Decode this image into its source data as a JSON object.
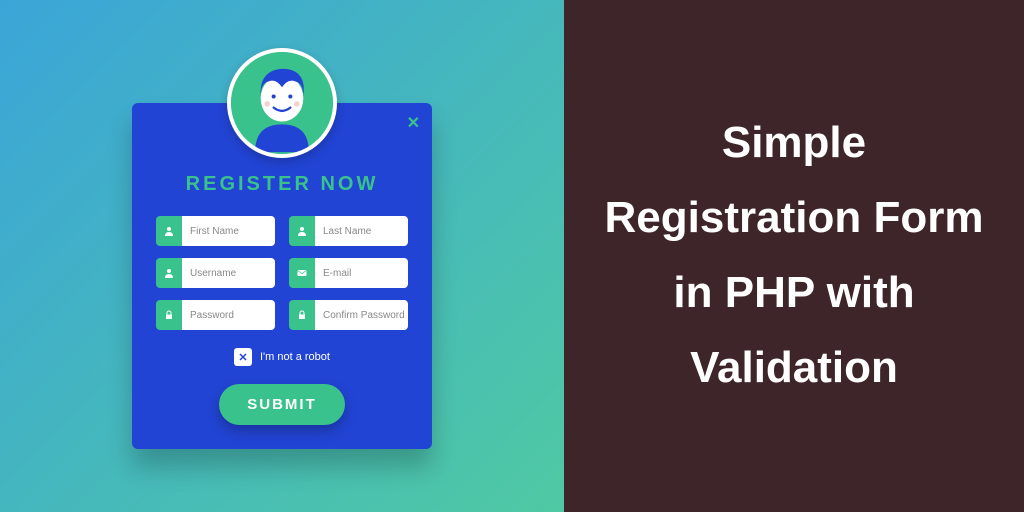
{
  "rightPanel": {
    "title": "Simple Registration Form in PHP with Validation"
  },
  "form": {
    "title": "REGISTER NOW",
    "fields": {
      "firstName": {
        "placeholder": "First Name"
      },
      "lastName": {
        "placeholder": "Last Name"
      },
      "username": {
        "placeholder": "Username"
      },
      "email": {
        "placeholder": "E-mail"
      },
      "password": {
        "placeholder": "Password"
      },
      "confirmPassword": {
        "placeholder": "Confirm Password"
      }
    },
    "robotLabel": "I'm not a robot",
    "submitLabel": "SUBMIT"
  },
  "colors": {
    "accent": "#3ac28c",
    "cardBg": "#2244d4",
    "rightBg": "#3d2529"
  }
}
